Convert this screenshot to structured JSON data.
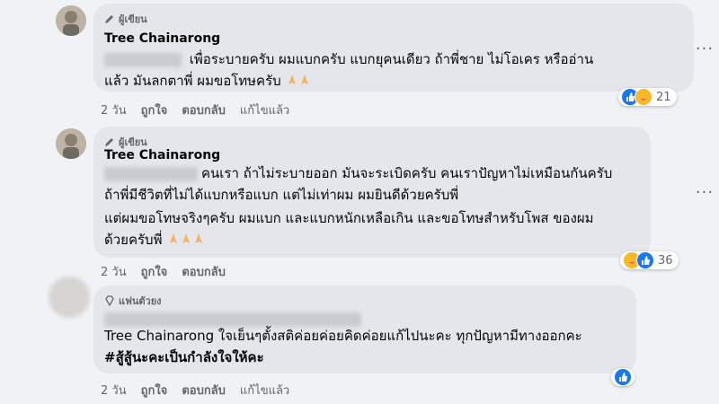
{
  "comments": [
    {
      "badge": "ผู้เขียน",
      "author": "Tree Chainarong",
      "line1": "เพื่อระบายครับ ผมแบกครับ แบกยุคนเดียว ถ้าพี่ชาย ไม่โอเคร หรืออ่าน",
      "line2": "แล้ว มันลกตาพี่ ผมขอโทษครับ",
      "time": "2 วัน",
      "like": "ถูกใจ",
      "reply": "ตอบกลับ",
      "edited": "แก้ไขแล้ว",
      "reaction_count": "21"
    },
    {
      "badge": "ผู้เขียน",
      "author": "Tree Chainarong",
      "line1": "คนเรา ถ้าไม่ระบายออก มันจะระเบิดครับ คนเราปัญหาไม่เหมือนกันครับ",
      "line2": "ถ้าพี่มีชีวิตที่ไม่ได้แบกหรือแบก แต่ไม่เท่าผม ผมยินดีด้วยครับพี่",
      "line3": "แต่ผมขอโทษจริงๆครับ ผมแบก และแบกหนักเหลือเกิน และขอโทษสำหรับโพส ของผม",
      "line4": "ด้วยครับพี่",
      "time": "2 วัน",
      "like": "ถูกใจ",
      "reply": "ตอบกลับ",
      "reaction_count": "36"
    },
    {
      "badge": "แฟนตัวยง",
      "line1": "Tree Chainarong ใจเย็นๆตั้งสติค่อยค่อยคิดค่อยแก้ไปนะคะ ทุกปัญหามีทางออกคะ",
      "line2": "#สู้สู้นะคะเป็นกำลังใจให้คะ",
      "time": "2 วัน",
      "like": "ถูกใจ",
      "reply": "ตอบกลับ",
      "edited": "แก้ไขแล้ว"
    }
  ],
  "colors": {
    "like_blue": "#1877f2",
    "care_yellow": "#f7b928",
    "bubble": "#e4e6eb",
    "background": "#f0f2f5"
  },
  "icons": {
    "author_badge": "pencil-icon",
    "fan_badge": "diamond-icon",
    "more": "more-options-icon"
  }
}
